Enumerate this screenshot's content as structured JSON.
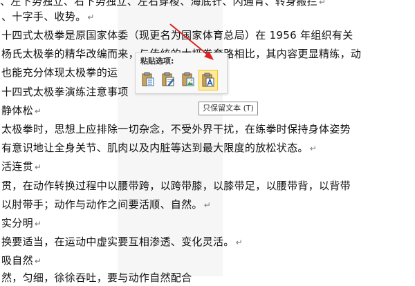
{
  "document": {
    "lines": [
      "、左下势独立、右下势独立、左右穿梭、海底针、闪通背、转身搬拦",
      "、十字手、收势。",
      "十四式太极拳是原国家体委（现更名为国家体育总局）在 1956 年组织有关",
      "杨氏太极拳的精华改编而来，与传统的太极拳套路相比，其内容更显精练，动",
      "也能充分体现太极拳的运",
      "十四式太极拳演练注意事项",
      "静体松",
      "太极拳时，思想上应排除一切杂念，不受外界干扰，在练拳时保持身体姿势",
      "有意识地让全身关节、肌肉以及内脏等达到最大限度的放松状态。",
      "活连贯",
      "贯，在动作转换过程中以腰带跨，以跨带膝，以膝带足，以腰带背，以背带",
      "以肘带手；动作与动作之间要活顺、自然。",
      "实分明",
      "换要适当，在运动中虚实要互相渗透、变化灵活。",
      "吸自然",
      "然，匀细，徐徐吞吐，要与动作自然配合"
    ]
  },
  "paste_menu": {
    "title": "粘贴选项:",
    "options": [
      {
        "icon": "keep-source-formatting-icon"
      },
      {
        "icon": "merge-formatting-icon"
      },
      {
        "icon": "picture-paste-icon"
      },
      {
        "icon": "keep-text-only-icon"
      }
    ],
    "selected_index": 3,
    "tooltip": "只保留文本 (T)"
  },
  "annotation": {
    "arrow_color": "#e02020"
  }
}
